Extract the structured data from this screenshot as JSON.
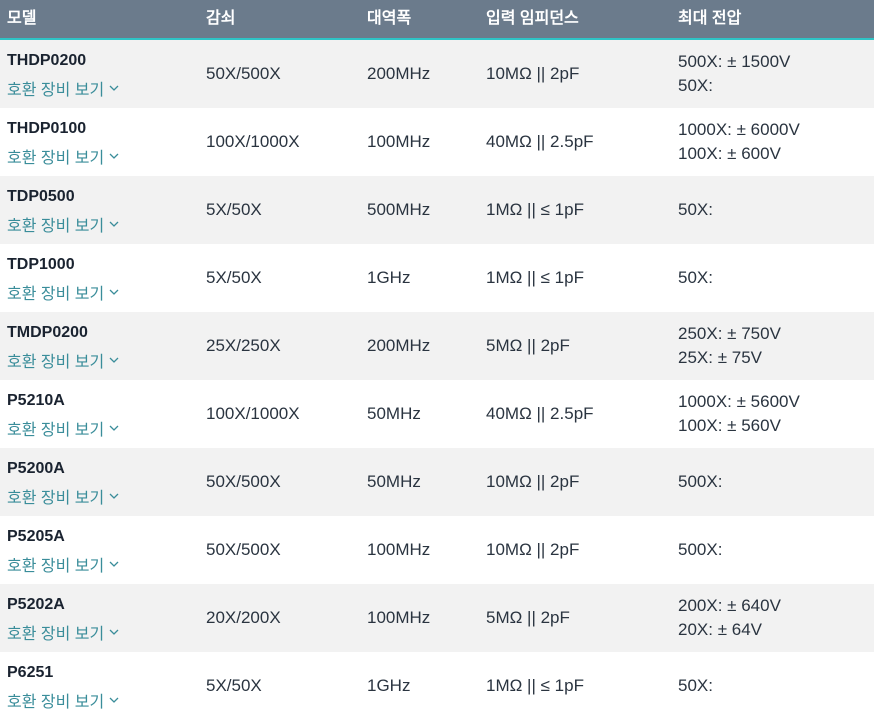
{
  "header": {
    "model": "모델",
    "attenuation": "감쇠",
    "bandwidth": "대역폭",
    "input_impedance": "입력 임피던스",
    "max_voltage": "최대 전압"
  },
  "compat_label": "호환 장비 보기",
  "colors": {
    "header_bg": "#6b7b8c",
    "header_accent": "#2ec4c6",
    "link": "#3a8d9a",
    "row_alt": "#f2f2f2"
  },
  "rows": [
    {
      "model": "THDP0200",
      "attenuation": "50X/500X",
      "bandwidth": "200MHz",
      "impedance": "10MΩ || 2pF",
      "voltage": [
        "500X: ± 1500V",
        "50X:"
      ]
    },
    {
      "model": "THDP0100",
      "attenuation": "100X/1000X",
      "bandwidth": "100MHz",
      "impedance": "40MΩ || 2.5pF",
      "voltage": [
        "1000X: ± 6000V",
        "100X: ± 600V"
      ]
    },
    {
      "model": "TDP0500",
      "attenuation": "5X/50X",
      "bandwidth": "500MHz",
      "impedance": "1MΩ || ≤ 1pF",
      "voltage": [
        "50X:"
      ]
    },
    {
      "model": "TDP1000",
      "attenuation": "5X/50X",
      "bandwidth": "1GHz",
      "impedance": "1MΩ || ≤ 1pF",
      "voltage": [
        "50X:"
      ]
    },
    {
      "model": "TMDP0200",
      "attenuation": "25X/250X",
      "bandwidth": "200MHz",
      "impedance": "5MΩ || 2pF",
      "voltage": [
        "250X: ± 750V",
        "25X: ± 75V"
      ]
    },
    {
      "model": "P5210A",
      "attenuation": "100X/1000X",
      "bandwidth": "50MHz",
      "impedance": "40MΩ || 2.5pF",
      "voltage": [
        "1000X: ± 5600V",
        "100X: ± 560V"
      ]
    },
    {
      "model": "P5200A",
      "attenuation": "50X/500X",
      "bandwidth": "50MHz",
      "impedance": "10MΩ || 2pF",
      "voltage": [
        "500X:"
      ]
    },
    {
      "model": "P5205A",
      "attenuation": "50X/500X",
      "bandwidth": "100MHz",
      "impedance": "10MΩ || 2pF",
      "voltage": [
        "500X:"
      ]
    },
    {
      "model": "P5202A",
      "attenuation": "20X/200X",
      "bandwidth": "100MHz",
      "impedance": "5MΩ || 2pF",
      "voltage": [
        "200X: ± 640V",
        "20X: ± 64V"
      ]
    },
    {
      "model": "P6251",
      "attenuation": "5X/50X",
      "bandwidth": "1GHz",
      "impedance": "1MΩ || ≤ 1pF",
      "voltage": [
        "50X:"
      ]
    }
  ]
}
